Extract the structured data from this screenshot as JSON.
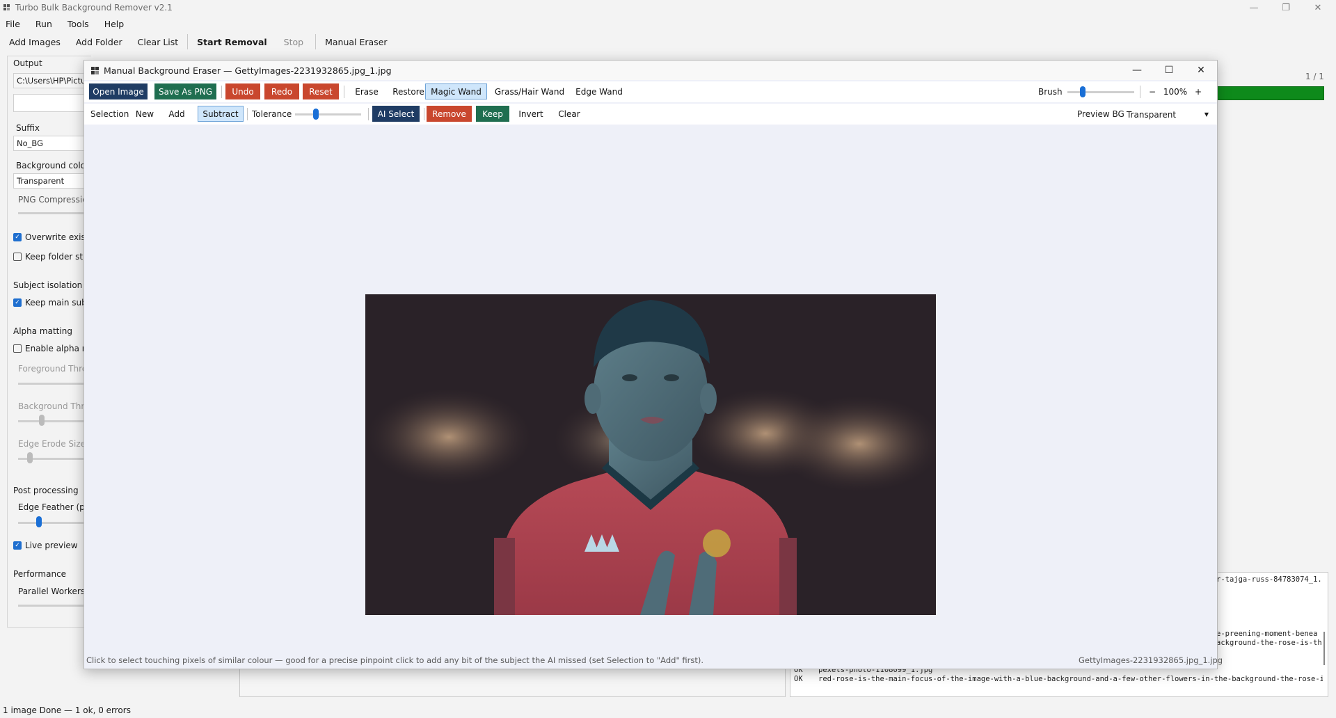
{
  "app": {
    "title": "Turbo Bulk Background Remover v2.1",
    "menu": [
      "File",
      "Run",
      "Tools",
      "Help"
    ],
    "toolbar": {
      "add_images": "Add Images",
      "add_folder": "Add Folder",
      "clear_list": "Clear List",
      "start_removal": "Start Removal",
      "stop": "Stop",
      "manual_eraser": "Manual Eraser"
    }
  },
  "left_panel": {
    "output_label": "Output",
    "output_path": "C:\\Users\\HP\\Pictu",
    "suffix_label": "Suffix",
    "suffix_value": "No_BG",
    "bg_colour_label": "Background colou",
    "bg_colour_value": "Transparent",
    "png_compression_label": "PNG Compressio",
    "overwrite_label": "Overwrite existin",
    "keep_folder_label": "Keep folder stru",
    "subject_isolation_label": "Subject isolation",
    "keep_main_subject_label": "Keep main subje",
    "alpha_matting_label": "Alpha matting",
    "enable_alpha_label": "Enable alpha ma",
    "fg_threshold_label": "Foreground Thres",
    "bg_threshold_label": "Background Thres",
    "edge_erode_label": "Edge Erode Size",
    "post_processing_label": "Post processing",
    "edge_feather_label": "Edge Feather (px)",
    "live_preview_label": "Live preview",
    "performance_label": "Performance",
    "parallel_workers_label": "Parallel Workers",
    "checks": {
      "overwrite": true,
      "keep_folder": false,
      "keep_main_subject": true,
      "enable_alpha": false,
      "live_preview": true
    }
  },
  "progress": {
    "label": "1 / 1",
    "fraction": 1.0
  },
  "log_lines": [
    "r-tajga-russ-84783074_1.",
    "e-preening-moment-benea",
    "ackground-the-rose-is-th",
    "pexels-photo-1108099_1.jpg",
    "red-rose-is-the-main-focus-of-the-image-with-a-blue-background-and-a-few-other-flowers-in-the-background-the-rose-is-th"
  ],
  "log_status": [
    "OK",
    "OK"
  ],
  "statusbar": "1 image  Done — 1 ok, 0 errors",
  "dialog": {
    "title": "Manual Background Eraser — GettyImages-2231932865.jpg_1.jpg",
    "row1": {
      "open_image": "Open Image",
      "save_as_png": "Save As PNG",
      "undo": "Undo",
      "redo": "Redo",
      "reset": "Reset",
      "erase": "Erase",
      "restore": "Restore",
      "magic_wand": "Magic Wand",
      "grass_hair_wand": "Grass/Hair Wand",
      "edge_wand": "Edge Wand",
      "brush_label": "Brush",
      "zoom_minus": "−",
      "zoom_value": "100%",
      "zoom_plus": "+"
    },
    "row2": {
      "selection_label": "Selection",
      "new": "New",
      "add": "Add",
      "subtract": "Subtract",
      "tolerance_label": "Tolerance",
      "ai_select": "AI Select",
      "remove": "Remove",
      "keep": "Keep",
      "invert": "Invert",
      "clear": "Clear",
      "preview_bg_label": "Preview BG",
      "preview_bg_value": "Transparent"
    },
    "hint": "Click to select touching pixels of similar colour — good for a precise pinpoint click to add any bit of the subject the AI missed (set Selection to \"Add\" first).",
    "filename": "GettyImages-2231932865.jpg_1.jpg"
  },
  "colors": {
    "navy": "#1f3c64",
    "green": "#1f6e50",
    "red": "#c9472e",
    "active": "#cfe6fb",
    "progress": "#0e8a1b"
  }
}
